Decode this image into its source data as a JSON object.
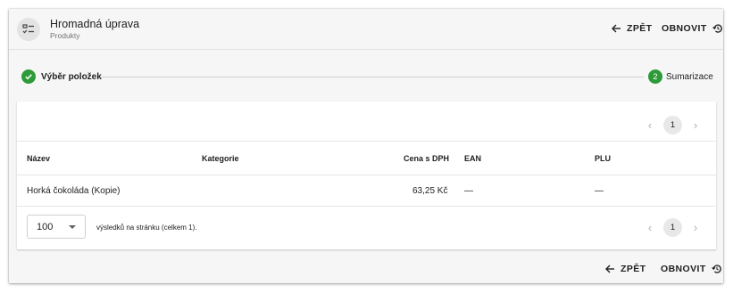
{
  "header": {
    "title": "Hromadná úprava",
    "subtitle": "Produkty",
    "back_label": "ZPĚT",
    "refresh_label": "OBNOVIT"
  },
  "stepper": {
    "steps": [
      {
        "label": "Výběr položek",
        "state": "done"
      },
      {
        "number": "2",
        "label": "Sumarizace",
        "state": "active"
      }
    ]
  },
  "pagination": {
    "current_page": "1",
    "prev_symbol": "‹",
    "next_symbol": "›"
  },
  "table": {
    "columns": [
      "Název",
      "Kategorie",
      "Cena s DPH",
      "EAN",
      "PLU"
    ],
    "rows": [
      {
        "name": "Horká čokoláda (Kopie)",
        "category": "",
        "price": "63,25 Kč",
        "ean": "—",
        "plu": "—"
      }
    ]
  },
  "footer": {
    "page_size": "100",
    "results_text": "výsledků na stránku (celkem 1)."
  },
  "actions": {
    "back_label": "ZPĚT",
    "refresh_label": "OBNOVIT"
  },
  "colors": {
    "accent_green": "#2e9b3a",
    "background": "#f6f6f6"
  }
}
